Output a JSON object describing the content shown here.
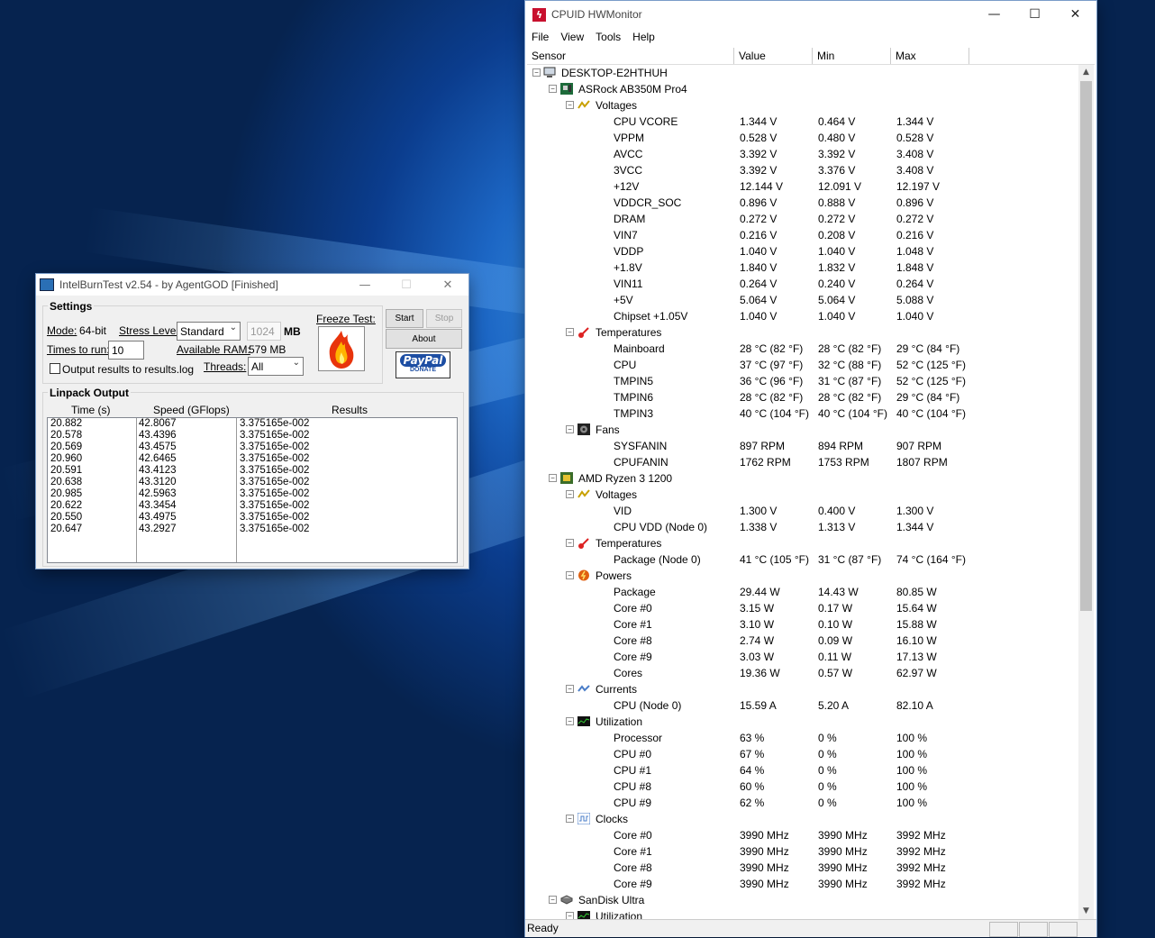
{
  "ibt": {
    "title": "IntelBurnTest v2.54 - by AgentGOD [Finished]",
    "settings_title": "Settings",
    "mode_label": "Mode:",
    "mode_value": "64-bit",
    "stress_label": "Stress Level:",
    "stress_value": "Standard",
    "mem_value": "1024",
    "mem_unit": "MB",
    "times_label": "Times to run:",
    "times_value": "10",
    "ram_label": "Available RAM:",
    "ram_value": "579 MB",
    "threads_label": "Threads:",
    "threads_value": "All",
    "output_checkbox": "Output results to results.log",
    "freeze_label": "Freeze Test:",
    "start": "Start",
    "stop": "Stop",
    "about": "About",
    "paypal": "PayPal",
    "donate": "DONATE",
    "output_title": "Linpack Output",
    "col_time": "Time (s)",
    "col_speed": "Speed (GFlops)",
    "col_results": "Results",
    "times": [
      "20.882",
      "20.578",
      "20.569",
      "20.960",
      "20.591",
      "20.638",
      "20.985",
      "20.622",
      "20.550",
      "20.647"
    ],
    "speeds": [
      "42.8067",
      "43.4396",
      "43.4575",
      "42.6465",
      "43.4123",
      "43.3120",
      "42.5963",
      "43.3454",
      "43.4975",
      "43.2927"
    ],
    "results": [
      "3.375165e-002",
      "3.375165e-002",
      "3.375165e-002",
      "3.375165e-002",
      "3.375165e-002",
      "3.375165e-002",
      "3.375165e-002",
      "3.375165e-002",
      "3.375165e-002",
      "3.375165e-002"
    ]
  },
  "hw": {
    "title": "CPUID HWMonitor",
    "menu": [
      "File",
      "View",
      "Tools",
      "Help"
    ],
    "headers": {
      "sensor": "Sensor",
      "value": "Value",
      "min": "Min",
      "max": "Max"
    },
    "status": "Ready",
    "rows": [
      {
        "lvl": 0,
        "icon": "computer-icon",
        "name": "DESKTOP-E2HTHUH"
      },
      {
        "lvl": 1,
        "icon": "motherboard-icon",
        "name": "ASRock AB350M Pro4"
      },
      {
        "lvl": 2,
        "icon": "voltage-icon",
        "name": "Voltages"
      },
      {
        "lvl": 3,
        "name": "CPU VCORE",
        "v": "1.344 V",
        "mn": "0.464 V",
        "mx": "1.344 V"
      },
      {
        "lvl": 3,
        "name": "VPPM",
        "v": "0.528 V",
        "mn": "0.480 V",
        "mx": "0.528 V"
      },
      {
        "lvl": 3,
        "name": "AVCC",
        "v": "3.392 V",
        "mn": "3.392 V",
        "mx": "3.408 V"
      },
      {
        "lvl": 3,
        "name": "3VCC",
        "v": "3.392 V",
        "mn": "3.376 V",
        "mx": "3.408 V"
      },
      {
        "lvl": 3,
        "name": "+12V",
        "v": "12.144 V",
        "mn": "12.091 V",
        "mx": "12.197 V"
      },
      {
        "lvl": 3,
        "name": "VDDCR_SOC",
        "v": "0.896 V",
        "mn": "0.888 V",
        "mx": "0.896 V"
      },
      {
        "lvl": 3,
        "name": "DRAM",
        "v": "0.272 V",
        "mn": "0.272 V",
        "mx": "0.272 V"
      },
      {
        "lvl": 3,
        "name": "VIN7",
        "v": "0.216 V",
        "mn": "0.208 V",
        "mx": "0.216 V"
      },
      {
        "lvl": 3,
        "name": "VDDP",
        "v": "1.040 V",
        "mn": "1.040 V",
        "mx": "1.048 V"
      },
      {
        "lvl": 3,
        "name": "+1.8V",
        "v": "1.840 V",
        "mn": "1.832 V",
        "mx": "1.848 V"
      },
      {
        "lvl": 3,
        "name": "VIN11",
        "v": "0.264 V",
        "mn": "0.240 V",
        "mx": "0.264 V"
      },
      {
        "lvl": 3,
        "name": "+5V",
        "v": "5.064 V",
        "mn": "5.064 V",
        "mx": "5.088 V"
      },
      {
        "lvl": 3,
        "name": "Chipset +1.05V",
        "v": "1.040 V",
        "mn": "1.040 V",
        "mx": "1.040 V"
      },
      {
        "lvl": 2,
        "icon": "thermometer-icon",
        "name": "Temperatures"
      },
      {
        "lvl": 3,
        "name": "Mainboard",
        "v": "28 °C  (82 °F)",
        "mn": "28 °C  (82 °F)",
        "mx": "29 °C  (84 °F)"
      },
      {
        "lvl": 3,
        "name": "CPU",
        "v": "37 °C  (97 °F)",
        "mn": "32 °C  (88 °F)",
        "mx": "52 °C  (125 °F)"
      },
      {
        "lvl": 3,
        "name": "TMPIN5",
        "v": "36 °C  (96 °F)",
        "mn": "31 °C  (87 °F)",
        "mx": "52 °C  (125 °F)"
      },
      {
        "lvl": 3,
        "name": "TMPIN6",
        "v": "28 °C  (82 °F)",
        "mn": "28 °C  (82 °F)",
        "mx": "29 °C  (84 °F)"
      },
      {
        "lvl": 3,
        "name": "TMPIN3",
        "v": "40 °C  (104 °F)",
        "mn": "40 °C  (104 °F)",
        "mx": "40 °C  (104 °F)"
      },
      {
        "lvl": 2,
        "icon": "fan-icon",
        "name": "Fans"
      },
      {
        "lvl": 3,
        "name": "SYSFANIN",
        "v": "897 RPM",
        "mn": "894 RPM",
        "mx": "907 RPM"
      },
      {
        "lvl": 3,
        "name": "CPUFANIN",
        "v": "1762 RPM",
        "mn": "1753 RPM",
        "mx": "1807 RPM"
      },
      {
        "lvl": 1,
        "icon": "cpu-icon",
        "name": "AMD Ryzen 3 1200"
      },
      {
        "lvl": 2,
        "icon": "voltage-icon",
        "name": "Voltages"
      },
      {
        "lvl": 3,
        "name": "VID",
        "v": "1.300 V",
        "mn": "0.400 V",
        "mx": "1.300 V"
      },
      {
        "lvl": 3,
        "name": "CPU VDD (Node 0)",
        "v": "1.338 V",
        "mn": "1.313 V",
        "mx": "1.344 V"
      },
      {
        "lvl": 2,
        "icon": "thermometer-icon",
        "name": "Temperatures"
      },
      {
        "lvl": 3,
        "name": "Package (Node 0)",
        "v": "41 °C  (105 °F)",
        "mn": "31 °C  (87 °F)",
        "mx": "74 °C  (164 °F)"
      },
      {
        "lvl": 2,
        "icon": "power-icon",
        "name": "Powers"
      },
      {
        "lvl": 3,
        "name": "Package",
        "v": "29.44 W",
        "mn": "14.43 W",
        "mx": "80.85 W"
      },
      {
        "lvl": 3,
        "name": "Core #0",
        "v": "3.15 W",
        "mn": "0.17 W",
        "mx": "15.64 W"
      },
      {
        "lvl": 3,
        "name": "Core #1",
        "v": "3.10 W",
        "mn": "0.10 W",
        "mx": "15.88 W"
      },
      {
        "lvl": 3,
        "name": "Core #8",
        "v": "2.74 W",
        "mn": "0.09 W",
        "mx": "16.10 W"
      },
      {
        "lvl": 3,
        "name": "Core #9",
        "v": "3.03 W",
        "mn": "0.11 W",
        "mx": "17.13 W"
      },
      {
        "lvl": 3,
        "name": "Cores",
        "v": "19.36 W",
        "mn": "0.57 W",
        "mx": "62.97 W"
      },
      {
        "lvl": 2,
        "icon": "current-icon",
        "name": "Currents"
      },
      {
        "lvl": 3,
        "name": "CPU (Node 0)",
        "v": "15.59 A",
        "mn": "5.20 A",
        "mx": "82.10 A"
      },
      {
        "lvl": 2,
        "icon": "utilization-icon",
        "name": "Utilization"
      },
      {
        "lvl": 3,
        "name": "Processor",
        "v": "63 %",
        "mn": "0 %",
        "mx": "100 %"
      },
      {
        "lvl": 3,
        "name": "CPU #0",
        "v": "67 %",
        "mn": "0 %",
        "mx": "100 %"
      },
      {
        "lvl": 3,
        "name": "CPU #1",
        "v": "64 %",
        "mn": "0 %",
        "mx": "100 %"
      },
      {
        "lvl": 3,
        "name": "CPU #8",
        "v": "60 %",
        "mn": "0 %",
        "mx": "100 %"
      },
      {
        "lvl": 3,
        "name": "CPU #9",
        "v": "62 %",
        "mn": "0 %",
        "mx": "100 %"
      },
      {
        "lvl": 2,
        "icon": "clock-icon",
        "name": "Clocks"
      },
      {
        "lvl": 3,
        "name": "Core #0",
        "v": "3990 MHz",
        "mn": "3990 MHz",
        "mx": "3992 MHz"
      },
      {
        "lvl": 3,
        "name": "Core #1",
        "v": "3990 MHz",
        "mn": "3990 MHz",
        "mx": "3992 MHz"
      },
      {
        "lvl": 3,
        "name": "Core #8",
        "v": "3990 MHz",
        "mn": "3990 MHz",
        "mx": "3992 MHz"
      },
      {
        "lvl": 3,
        "name": "Core #9",
        "v": "3990 MHz",
        "mn": "3990 MHz",
        "mx": "3992 MHz"
      },
      {
        "lvl": 1,
        "icon": "disk-icon",
        "name": "SanDisk Ultra"
      },
      {
        "lvl": 2,
        "icon": "utilization-icon",
        "name": "Utilization"
      }
    ]
  }
}
